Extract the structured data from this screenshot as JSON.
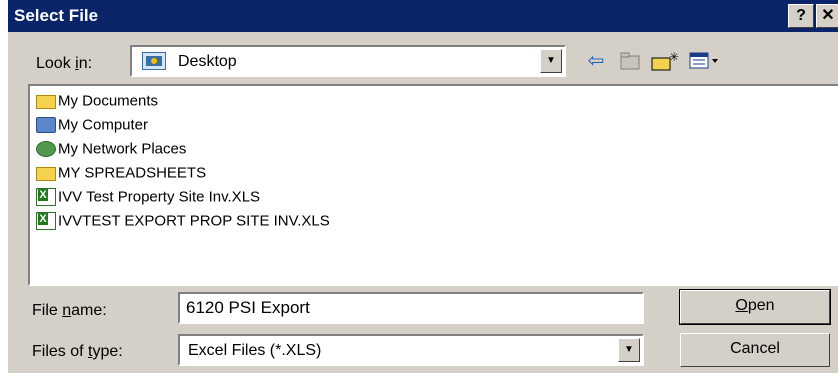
{
  "window": {
    "title": "Select File",
    "help_label": "?",
    "close_label": "✕"
  },
  "look_in": {
    "label_pre": "Look ",
    "label_accel": "i",
    "label_post": "n:",
    "value": "Desktop",
    "icon": "desktop-icon"
  },
  "toolbar": {
    "back_icon": "back-arrow-icon",
    "up_folder_icon": "up-folder-icon",
    "new_folder_icon": "new-folder-icon",
    "view_menu_icon": "view-menu-icon"
  },
  "files": [
    {
      "label": "My Documents",
      "icon": "folder-icon"
    },
    {
      "label": "My Computer",
      "icon": "computer-icon"
    },
    {
      "label": "My Network Places",
      "icon": "network-icon"
    },
    {
      "label": "MY SPREADSHEETS",
      "icon": "folder-icon"
    },
    {
      "label": "IVV Test Property Site Inv.XLS",
      "icon": "excel-file-icon"
    },
    {
      "label": "IVVTEST EXPORT PROP SITE INV.XLS",
      "icon": "excel-file-icon"
    }
  ],
  "file_name": {
    "label_pre": "File ",
    "label_accel": "n",
    "label_post": "ame:",
    "value": "6120 PSI Export"
  },
  "file_type": {
    "label_pre": "Files of ",
    "label_accel": "t",
    "label_post": "ype:",
    "value": "Excel Files (*.XLS)"
  },
  "buttons": {
    "open_accel": "O",
    "open_rest": "pen",
    "cancel": "Cancel"
  }
}
